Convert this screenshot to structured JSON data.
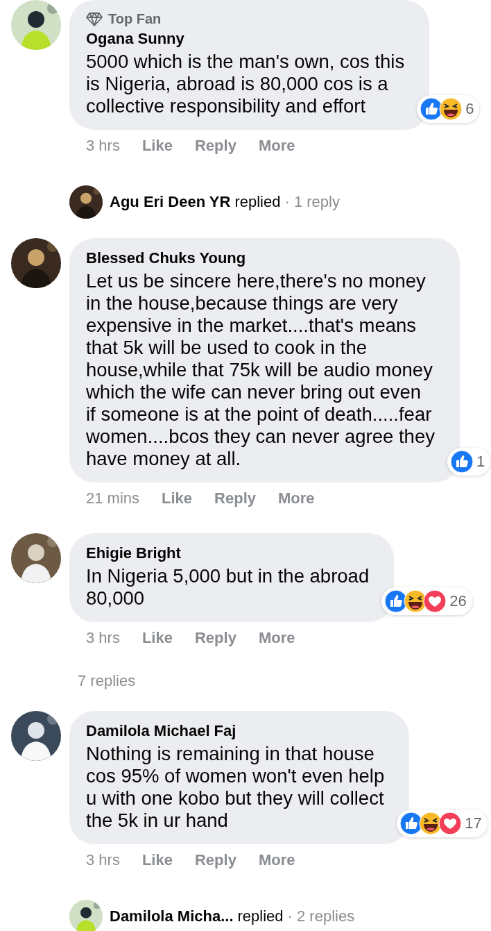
{
  "comments": [
    {
      "badge": "Top Fan",
      "author": "Ogana Sunny",
      "text": "5000 which is the man's own, cos this\nis Nigeria, abroad is 80,000 cos is a\ncollective responsibility and effort",
      "reactions": [
        {
          "kind": "like"
        },
        {
          "kind": "haha"
        }
      ],
      "reaction_count": "6",
      "time": "3 hrs",
      "actions": [
        "Like",
        "Reply",
        "More"
      ],
      "avatar": {
        "kind": "picture"
      },
      "reply_summary": {
        "name": "Agu Eri Deen YR",
        "verb": "replied",
        "count": "· 1 reply"
      }
    },
    {
      "author": "Blessed Chuks Young",
      "text": "Let us be sincere here,there's no money\nin the house,because things are very\nexpensive in the market....that's means\nthat 5k will be used to cook in the\nhouse,while that 75k will be audio money\nwhich the wife can never bring out even\nif someone is at the point of death.....fear\nwomen....bcos they can never agree they\nhave money at all.",
      "reactions": [
        {
          "kind": "like"
        }
      ],
      "reaction_count": "1",
      "time": "21 mins",
      "actions": [
        "Like",
        "Reply",
        "More"
      ],
      "avatar": {
        "kind": "picture"
      }
    },
    {
      "author": "Ehigie Bright",
      "text": "In Nigeria 5,000 but in the abroad\n80,000",
      "reactions": [
        {
          "kind": "like"
        },
        {
          "kind": "haha"
        },
        {
          "kind": "love"
        }
      ],
      "reaction_count": "26",
      "time": "3 hrs",
      "actions": [
        "Like",
        "Reply",
        "More"
      ],
      "avatar": {
        "kind": "picture"
      },
      "more_replies": "7 replies"
    },
    {
      "author": "Damilola Michael Faj",
      "text": "Nothing is remaining in that house\ncos 95% of women won't even help\nu with one kobo but they will collect\nthe 5k in ur hand",
      "reactions": [
        {
          "kind": "like"
        },
        {
          "kind": "haha"
        },
        {
          "kind": "love"
        }
      ],
      "reaction_count": "17",
      "time": "3 hrs",
      "actions": [
        "Like",
        "Reply",
        "More"
      ],
      "avatar": {
        "kind": "picture"
      },
      "reply_summary": {
        "name": "Damilola Micha...",
        "verb": "replied",
        "count": "· 2 replies"
      }
    }
  ]
}
